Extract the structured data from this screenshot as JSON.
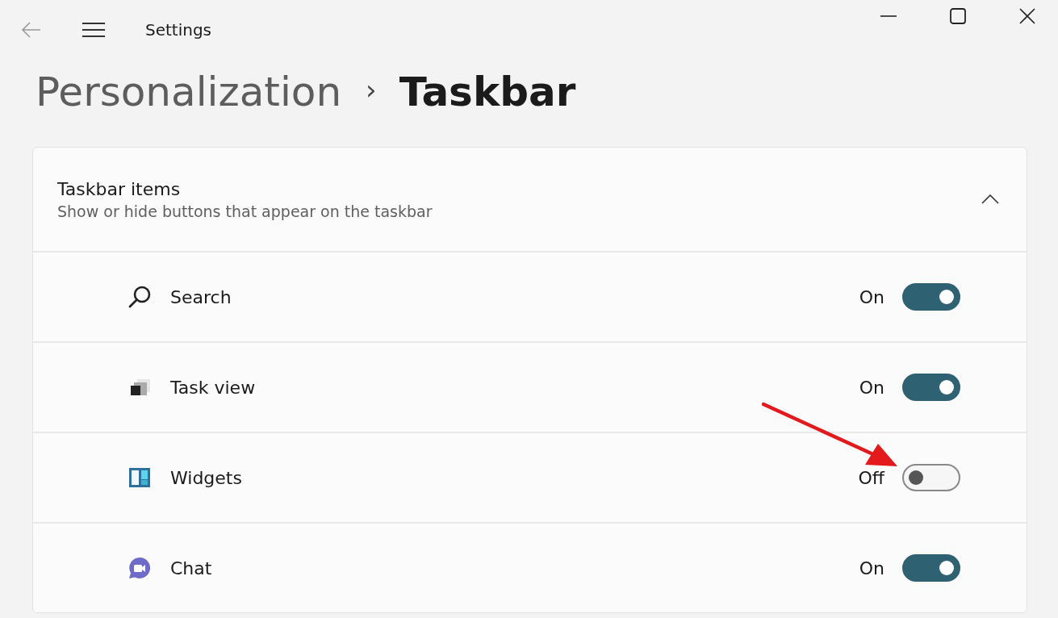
{
  "window": {
    "title": "Settings"
  },
  "breadcrumb": {
    "parent": "Personalization",
    "separator": "›",
    "current": "Taskbar"
  },
  "section": {
    "title": "Taskbar items",
    "subtitle": "Show or hide buttons that appear on the taskbar",
    "expanded": true,
    "items": [
      {
        "kind": "search",
        "label": "Search",
        "state_text": "On",
        "on": true
      },
      {
        "kind": "taskview",
        "label": "Task view",
        "state_text": "On",
        "on": true
      },
      {
        "kind": "widgets",
        "label": "Widgets",
        "state_text": "Off",
        "on": false
      },
      {
        "kind": "chat",
        "label": "Chat",
        "state_text": "On",
        "on": true
      }
    ]
  }
}
